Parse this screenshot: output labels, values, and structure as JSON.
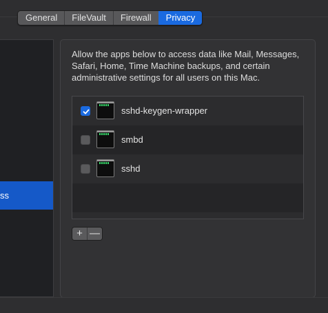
{
  "tabs": [
    {
      "label": "General",
      "active": false
    },
    {
      "label": "FileVault",
      "active": false
    },
    {
      "label": "Firewall",
      "active": false
    },
    {
      "label": "Privacy",
      "active": true
    }
  ],
  "sidebar": {
    "selected_item_label": "ss"
  },
  "panel": {
    "description": "Allow the apps below to access data like Mail, Messages, Safari, Home, Time Machine backups, and certain administrative settings for all users on this Mac.",
    "apps": [
      {
        "name": "sshd-keygen-wrapper",
        "checked": true,
        "icon": "terminal-icon"
      },
      {
        "name": "smbd",
        "checked": false,
        "icon": "terminal-icon"
      },
      {
        "name": "sshd",
        "checked": false,
        "icon": "terminal-icon"
      }
    ],
    "add_label": "+",
    "remove_label": "—"
  },
  "colors": {
    "accent": "#1a6ae0",
    "background": "#2e2e30",
    "sidebar": "#1f2023"
  }
}
